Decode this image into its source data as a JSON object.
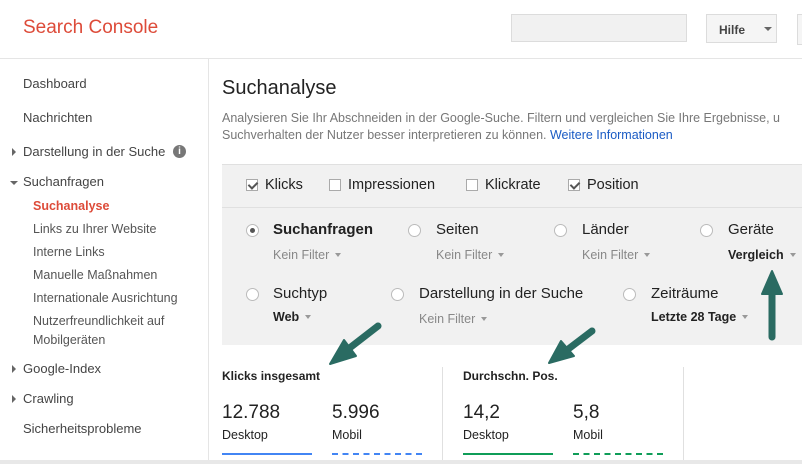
{
  "app": {
    "title": "Search Console"
  },
  "header": {
    "help_label": "Hilfe"
  },
  "sidebar": {
    "items": [
      {
        "label": "Dashboard"
      },
      {
        "label": "Nachrichten"
      },
      {
        "label": "Darstellung in der Suche"
      },
      {
        "label": "Suchanfragen"
      },
      {
        "label": "Suchanalyse"
      },
      {
        "label": "Links zu Ihrer Website"
      },
      {
        "label": "Interne Links"
      },
      {
        "label": "Manuelle Maßnahmen"
      },
      {
        "label": "Internationale Ausrichtung"
      },
      {
        "label": "Nutzerfreundlichkeit auf"
      },
      {
        "label": "Mobilgeräten"
      },
      {
        "label": "Google-Index"
      },
      {
        "label": "Crawling"
      },
      {
        "label": "Sicherheitsprobleme"
      }
    ]
  },
  "main": {
    "title": "Suchanalyse",
    "description_line1": "Analysieren Sie Ihr Abschneiden in der Google-Suche. Filtern und vergleichen Sie Ihre Ergebnisse, u",
    "description_line2": "Suchverhalten der Nutzer besser interpretieren zu können.",
    "more_info": "Weitere Informationen",
    "metrics": [
      {
        "label": "Klicks",
        "checked": true
      },
      {
        "label": "Impressionen",
        "checked": false
      },
      {
        "label": "Klickrate",
        "checked": false
      },
      {
        "label": "Position",
        "checked": true
      }
    ],
    "dimensions": [
      {
        "label": "Suchanfragen",
        "filter": "Kein Filter",
        "selected": true
      },
      {
        "label": "Seiten",
        "filter": "Kein Filter",
        "selected": false
      },
      {
        "label": "Länder",
        "filter": "Kein Filter",
        "selected": false
      },
      {
        "label": "Geräte",
        "filter": "Vergleich",
        "selected": false
      },
      {
        "label": "Suchtyp",
        "filter": "Web",
        "selected": false
      },
      {
        "label": "Darstellung in der Suche",
        "filter": "Kein Filter",
        "selected": false
      },
      {
        "label": "Zeiträume",
        "filter": "Letzte 28 Tage",
        "selected": false
      }
    ],
    "summaries": [
      {
        "title": "Klicks insgesamt",
        "values": [
          {
            "value": "12.788",
            "label": "Desktop"
          },
          {
            "value": "5.996",
            "label": "Mobil"
          }
        ]
      },
      {
        "title": "Durchschn. Pos.",
        "values": [
          {
            "value": "14,2",
            "label": "Desktop"
          },
          {
            "value": "5,8",
            "label": "Mobil"
          }
        ]
      }
    ]
  },
  "colors": {
    "accent": "#dd4b39",
    "link": "#1a5bc4",
    "clicks": "#4285f4",
    "position": "#0f9d58",
    "arrow": "#2a6b62"
  }
}
